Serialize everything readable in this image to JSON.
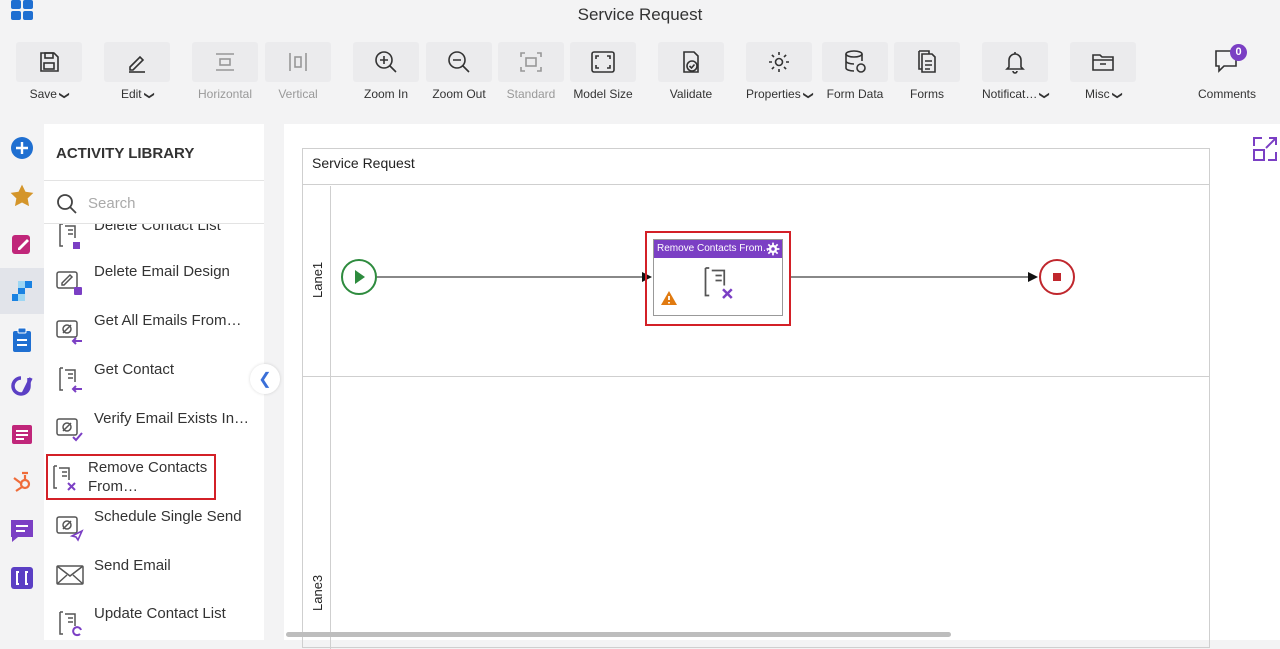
{
  "window": {
    "title": "Service Request"
  },
  "toolbar": {
    "save": "Save",
    "edit": "Edit",
    "horizontal": "Horizontal",
    "vertical": "Vertical",
    "zoom_in": "Zoom In",
    "zoom_out": "Zoom Out",
    "standard": "Standard",
    "model_size": "Model Size",
    "validate": "Validate",
    "properties": "Properties",
    "form_data": "Form Data",
    "forms": "Forms",
    "notifications": "Notificat…",
    "misc": "Misc"
  },
  "comments": {
    "label": "Comments",
    "count": "0"
  },
  "library": {
    "title": "ACTIVITY LIBRARY",
    "search_placeholder": "Search",
    "items": [
      {
        "label": "Delete Contact List",
        "icon": "delete-contact-list-icon"
      },
      {
        "label": "Delete Email Design",
        "icon": "delete-email-design-icon"
      },
      {
        "label": "Get All Emails From…",
        "icon": "get-all-emails-icon"
      },
      {
        "label": "Get Contact",
        "icon": "get-contact-icon"
      },
      {
        "label": "Verify Email Exists In…",
        "icon": "verify-email-icon"
      },
      {
        "label": "Remove Contacts From…",
        "icon": "remove-contacts-icon"
      },
      {
        "label": "Schedule Single Send",
        "icon": "schedule-send-icon"
      },
      {
        "label": "Send Email",
        "icon": "send-email-icon"
      },
      {
        "label": "Update Contact List",
        "icon": "update-contact-list-icon"
      }
    ]
  },
  "canvas": {
    "pool_title": "Service Request",
    "lane1": "Lane1",
    "lane3": "Lane3",
    "task_title": "Remove Contacts From…"
  },
  "colors": {
    "accent": "#7b3fc4",
    "highlight": "#d32027",
    "start": "#2e8b3e",
    "end": "#c0272d",
    "warning": "#e07a10"
  }
}
